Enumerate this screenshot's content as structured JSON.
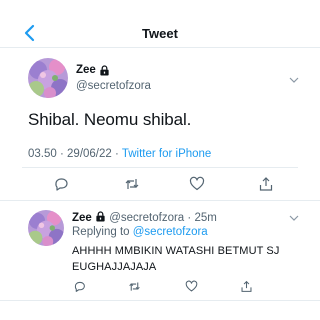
{
  "header": {
    "title": "Tweet"
  },
  "main_tweet": {
    "name": "Zee",
    "handle": "@secretofzora",
    "text": "Shibal. Neomu shibal.",
    "time": "03.50",
    "separator": "·",
    "date": "29/06/22",
    "source": "Twitter for iPhone"
  },
  "reply_tweet": {
    "name": "Zee",
    "handle": "@secretofzora",
    "separator": "·",
    "age": "25m",
    "replying_prefix": "Replying to",
    "replying_to": "@secretofzora",
    "text": "AHHHH MMBIKIN WATASHI BETMUT SJ EUGHAJJAJAJA"
  },
  "colors": {
    "accent": "#1d9bf0",
    "secondary_text": "#536471",
    "divider": "#e6ecf0",
    "avatar_purple": "#9b7fd0",
    "avatar_pink": "#e58fc9",
    "avatar_green": "#a9c98a"
  },
  "icons": {
    "back": "chevron-left-icon",
    "lock": "lock-icon",
    "more": "chevron-down-icon",
    "reply": "reply-icon",
    "retweet": "retweet-icon",
    "like": "heart-icon",
    "share": "share-icon"
  }
}
